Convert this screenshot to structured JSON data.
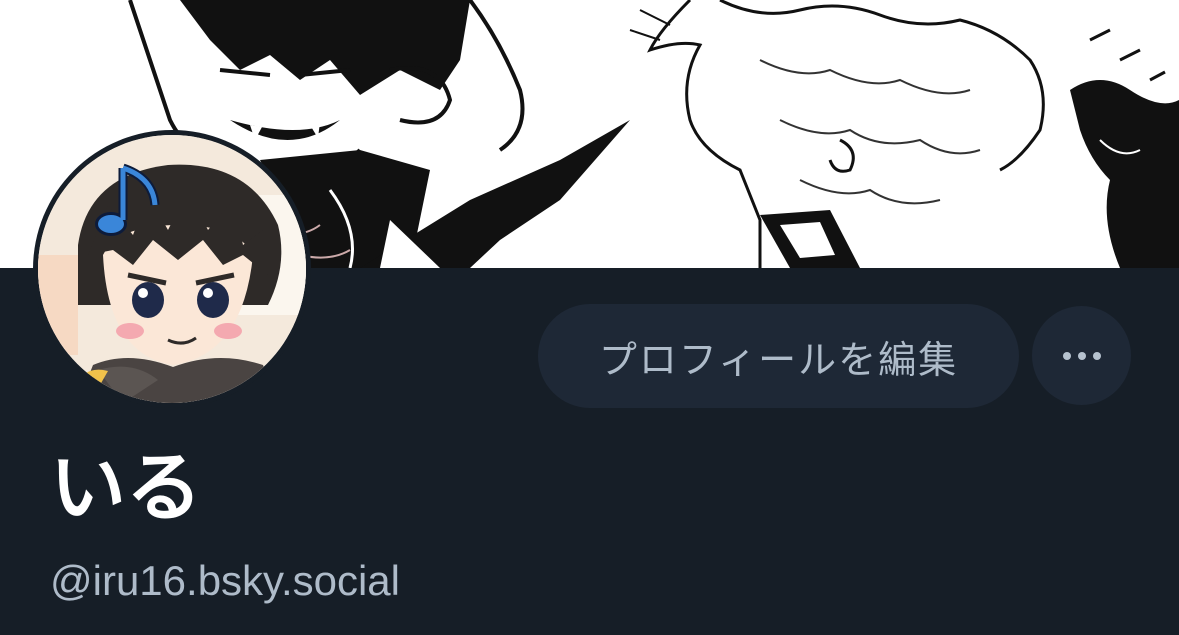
{
  "profile": {
    "display_name": "いる",
    "handle": "@iru16.bsky.social",
    "edit_profile_label": "プロフィールを編集",
    "more_label": "…"
  },
  "icons": {
    "more": "ellipsis-icon",
    "avatar_badge": "music-note-icon"
  },
  "colors": {
    "background": "#161e27",
    "button_background": "#1e2836",
    "secondary_text": "#aebbc9",
    "primary_text": "#ffffff",
    "accent_note": "#3a86d9"
  }
}
